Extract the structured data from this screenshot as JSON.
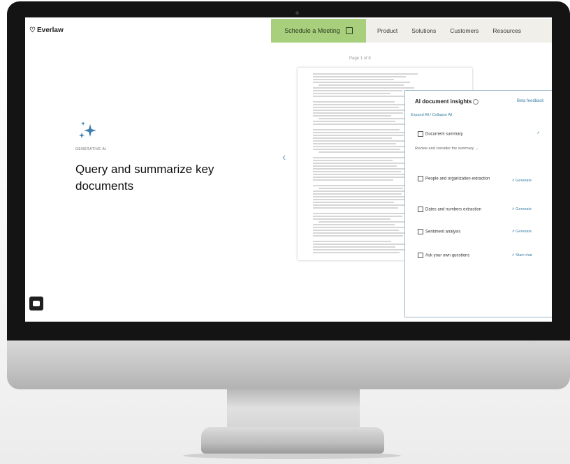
{
  "nav": {
    "logo": "Everlaw",
    "cta_label": "Schedule a Meeting",
    "menu": [
      "Product",
      "Solutions",
      "Customers",
      "Resources"
    ]
  },
  "hero": {
    "eyebrow": "GENERATIVE AI",
    "title": "Query and summarize key documents"
  },
  "viewer": {
    "page_indicator": "Page 1 of 8"
  },
  "panel": {
    "title": "AI document insights",
    "header_link": "Beta feedback",
    "subheader": "Expand All / Collapse All",
    "summary_note": "Review and consider the summary →",
    "features": [
      {
        "label": "Document summary",
        "action": "↗"
      },
      {
        "label": "People and organization extraction",
        "action": "↗ Generate"
      },
      {
        "label": "Dates and numbers extraction",
        "action": "↗ Generate"
      },
      {
        "label": "Sentiment analysis",
        "action": "↗ Generate"
      },
      {
        "label": "Ask your own questions",
        "action": "↗ Start chat"
      }
    ]
  },
  "colors": {
    "cta_bg": "#a8d07c",
    "nav_bg": "#f1efe9",
    "sparkle": "#3f7fb0",
    "link": "#3c80a6"
  },
  "icons": {
    "sparkle": "sparkle-icon",
    "chat": "chat-icon",
    "calendar": "calendar-icon",
    "prev": "chevron-left-icon"
  }
}
